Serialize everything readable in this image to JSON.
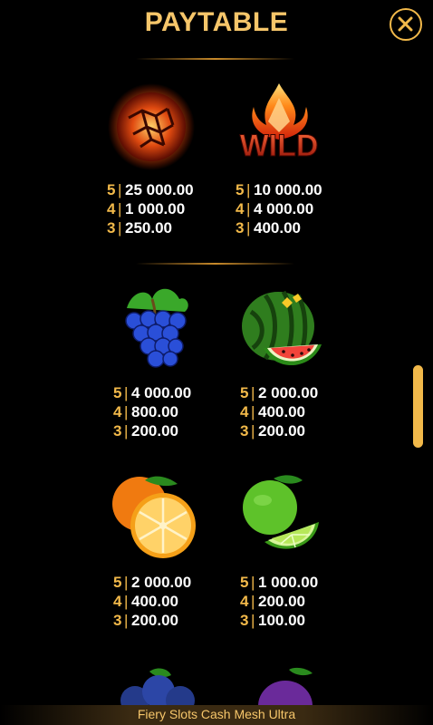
{
  "header": {
    "title": "PAYTABLE"
  },
  "symbols": [
    {
      "name": "fireball",
      "pays": [
        {
          "n": "5",
          "v": "25 000.00"
        },
        {
          "n": "4",
          "v": "1 000.00"
        },
        {
          "n": "3",
          "v": "250.00"
        }
      ]
    },
    {
      "name": "wild",
      "label": "WILD",
      "pays": [
        {
          "n": "5",
          "v": "10 000.00"
        },
        {
          "n": "4",
          "v": "4 000.00"
        },
        {
          "n": "3",
          "v": "400.00"
        }
      ]
    },
    {
      "name": "grapes",
      "pays": [
        {
          "n": "5",
          "v": "4 000.00"
        },
        {
          "n": "4",
          "v": "800.00"
        },
        {
          "n": "3",
          "v": "200.00"
        }
      ]
    },
    {
      "name": "watermelon",
      "pays": [
        {
          "n": "5",
          "v": "2 000.00"
        },
        {
          "n": "4",
          "v": "400.00"
        },
        {
          "n": "3",
          "v": "200.00"
        }
      ]
    },
    {
      "name": "orange",
      "pays": [
        {
          "n": "5",
          "v": "2 000.00"
        },
        {
          "n": "4",
          "v": "400.00"
        },
        {
          "n": "3",
          "v": "200.00"
        }
      ]
    },
    {
      "name": "lime",
      "pays": [
        {
          "n": "5",
          "v": "1 000.00"
        },
        {
          "n": "4",
          "v": "200.00"
        },
        {
          "n": "3",
          "v": "100.00"
        }
      ]
    }
  ],
  "footer": {
    "game_name": "Fiery Slots Cash Mesh Ultra"
  },
  "colors": {
    "accent": "#f2b94a",
    "title": "#f6c66a",
    "background": "#000000"
  }
}
